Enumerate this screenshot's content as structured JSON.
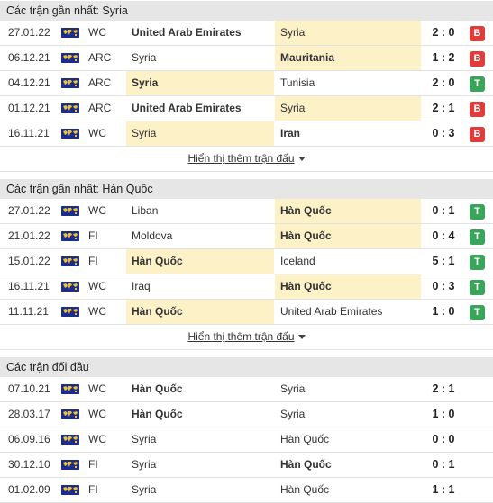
{
  "sections": [
    {
      "title": "Các trận gần nhất: Syria",
      "show_more": "Hiển thị thêm trận đấu",
      "rows": [
        {
          "date": "27.01.22",
          "comp": "WC",
          "home": "United Arab Emirates",
          "away": "Syria",
          "score": "2 : 0",
          "result": "B",
          "home_bold": true,
          "away_bold": false,
          "hl": "away"
        },
        {
          "date": "06.12.21",
          "comp": "ARC",
          "home": "Syria",
          "away": "Mauritania",
          "score": "1 : 2",
          "result": "B",
          "home_bold": false,
          "away_bold": true,
          "hl": "away"
        },
        {
          "date": "04.12.21",
          "comp": "ARC",
          "home": "Syria",
          "away": "Tunisia",
          "score": "2 : 0",
          "result": "T",
          "home_bold": true,
          "away_bold": false,
          "hl": "home"
        },
        {
          "date": "01.12.21",
          "comp": "ARC",
          "home": "United Arab Emirates",
          "away": "Syria",
          "score": "2 : 1",
          "result": "B",
          "home_bold": true,
          "away_bold": false,
          "hl": "away"
        },
        {
          "date": "16.11.21",
          "comp": "WC",
          "home": "Syria",
          "away": "Iran",
          "score": "0 : 3",
          "result": "B",
          "home_bold": false,
          "away_bold": true,
          "hl": "home"
        }
      ]
    },
    {
      "title": "Các trận gần nhất: Hàn Quốc",
      "show_more": "Hiển thị thêm trận đấu",
      "rows": [
        {
          "date": "27.01.22",
          "comp": "WC",
          "home": "Liban",
          "away": "Hàn Quốc",
          "score": "0 : 1",
          "result": "T",
          "home_bold": false,
          "away_bold": true,
          "hl": "away"
        },
        {
          "date": "21.01.22",
          "comp": "FI",
          "home": "Moldova",
          "away": "Hàn Quốc",
          "score": "0 : 4",
          "result": "T",
          "home_bold": false,
          "away_bold": true,
          "hl": "away"
        },
        {
          "date": "15.01.22",
          "comp": "FI",
          "home": "Hàn Quốc",
          "away": "Iceland",
          "score": "5 : 1",
          "result": "T",
          "home_bold": true,
          "away_bold": false,
          "hl": "home"
        },
        {
          "date": "16.11.21",
          "comp": "WC",
          "home": "Iraq",
          "away": "Hàn Quốc",
          "score": "0 : 3",
          "result": "T",
          "home_bold": false,
          "away_bold": true,
          "hl": "away"
        },
        {
          "date": "11.11.21",
          "comp": "WC",
          "home": "Hàn Quốc",
          "away": "United Arab Emirates",
          "score": "1 : 0",
          "result": "T",
          "home_bold": true,
          "away_bold": false,
          "hl": "home"
        }
      ]
    },
    {
      "title": "Các trận đối đầu",
      "show_more": "",
      "rows": [
        {
          "date": "07.10.21",
          "comp": "WC",
          "home": "Hàn Quốc",
          "away": "Syria",
          "score": "2 : 1",
          "result": "",
          "home_bold": true,
          "away_bold": false,
          "hl": ""
        },
        {
          "date": "28.03.17",
          "comp": "WC",
          "home": "Hàn Quốc",
          "away": "Syria",
          "score": "1 : 0",
          "result": "",
          "home_bold": true,
          "away_bold": false,
          "hl": ""
        },
        {
          "date": "06.09.16",
          "comp": "WC",
          "home": "Syria",
          "away": "Hàn Quốc",
          "score": "0 : 0",
          "result": "",
          "home_bold": false,
          "away_bold": false,
          "hl": ""
        },
        {
          "date": "30.12.10",
          "comp": "FI",
          "home": "Syria",
          "away": "Hàn Quốc",
          "score": "0 : 1",
          "result": "",
          "home_bold": false,
          "away_bold": true,
          "hl": ""
        },
        {
          "date": "01.02.09",
          "comp": "FI",
          "home": "Syria",
          "away": "Hàn Quốc",
          "score": "1 : 1",
          "result": "",
          "home_bold": false,
          "away_bold": false,
          "hl": ""
        }
      ]
    }
  ],
  "colors": {
    "loss": "#e03c3c",
    "win": "#3aa55a",
    "highlight": "#fdf1c8",
    "header_bg": "#e6e6e6"
  },
  "icons": {
    "competition": "world-map-flag-icon",
    "show_more": "caret-down-icon"
  }
}
